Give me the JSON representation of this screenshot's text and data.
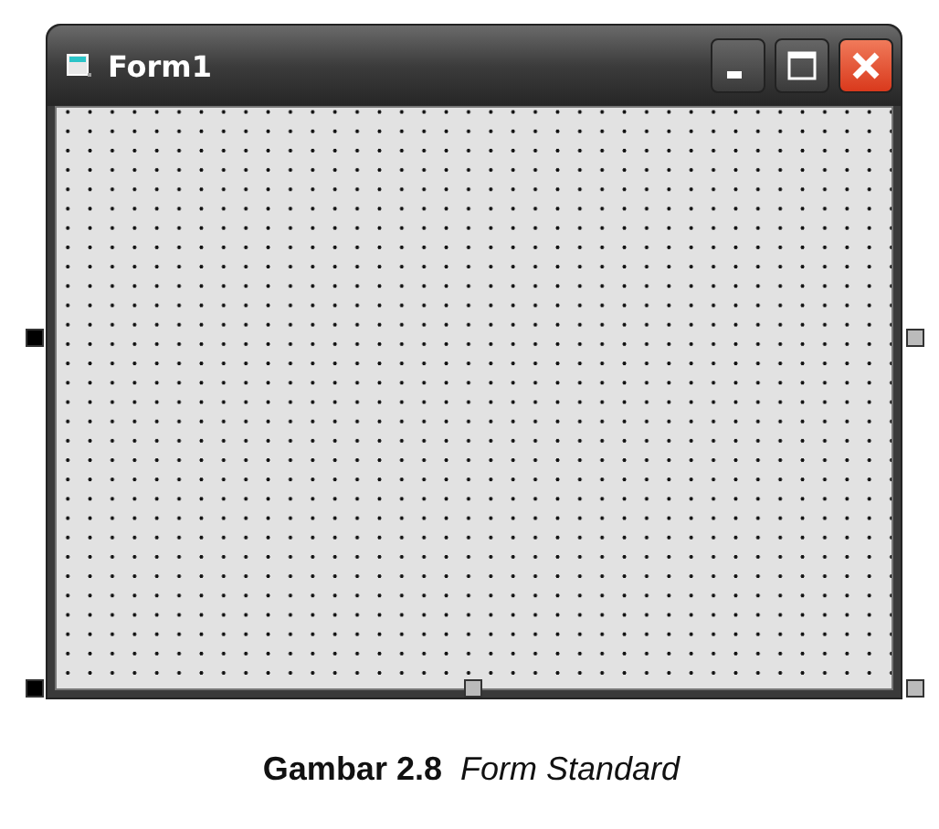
{
  "window": {
    "title": "Form1",
    "buttons": [
      {
        "kind": "minimize"
      },
      {
        "kind": "maximize"
      },
      {
        "kind": "close"
      }
    ]
  },
  "handles": [
    {
      "kind": "left",
      "resizable": false
    },
    {
      "kind": "right",
      "resizable": true
    },
    {
      "kind": "bottom-left",
      "resizable": false
    },
    {
      "kind": "bottom",
      "resizable": true
    },
    {
      "kind": "bottom-right",
      "resizable": true
    }
  ],
  "caption": "**Gambar 2.8**  *Form Standard*"
}
